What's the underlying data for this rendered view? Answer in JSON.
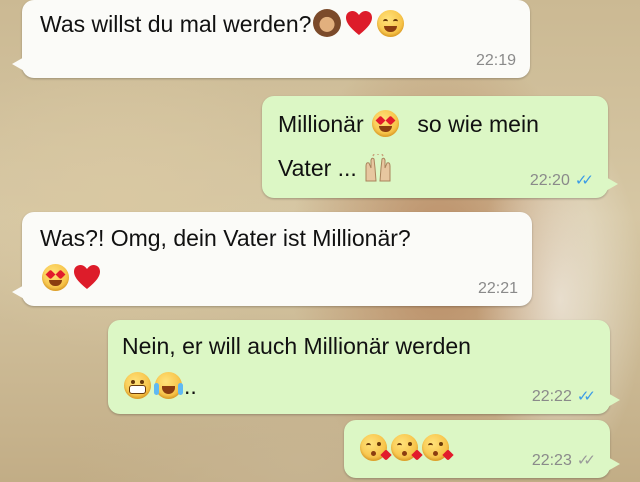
{
  "messages": [
    {
      "direction": "incoming",
      "text": "Was willst du mal werden?",
      "time": "22:19"
    },
    {
      "direction": "outgoing",
      "text_1": "Millionär",
      "text_2": "so wie mein",
      "text_3": "Vater ...",
      "time": "22:20",
      "status": "read"
    },
    {
      "direction": "incoming",
      "text": "Was?! Omg, dein Vater ist Millionär?",
      "time": "22:21"
    },
    {
      "direction": "outgoing",
      "text": "Nein, er will auch Millionär werden",
      "text_2": "..",
      "time": "22:22",
      "status": "read"
    },
    {
      "direction": "outgoing",
      "text": "",
      "time": "22:23",
      "status": "delivered"
    }
  ],
  "emoji": {
    "msg1": [
      "see-no-evil-monkey",
      "red-heart",
      "smiling-face"
    ],
    "msg2": [
      "heart-eyes",
      "raising-hands"
    ],
    "msg3": [
      "heart-eyes",
      "red-heart"
    ],
    "msg4": [
      "grimacing-face",
      "crying-laughing"
    ],
    "msg5": [
      "kissing-heart",
      "kissing-heart",
      "kissing-heart"
    ]
  },
  "colors": {
    "incoming": "#fbfbf8",
    "outgoing": "#dcf7c5",
    "read_ticks": "#3b9be6",
    "sent_ticks": "#9a9a9a"
  }
}
